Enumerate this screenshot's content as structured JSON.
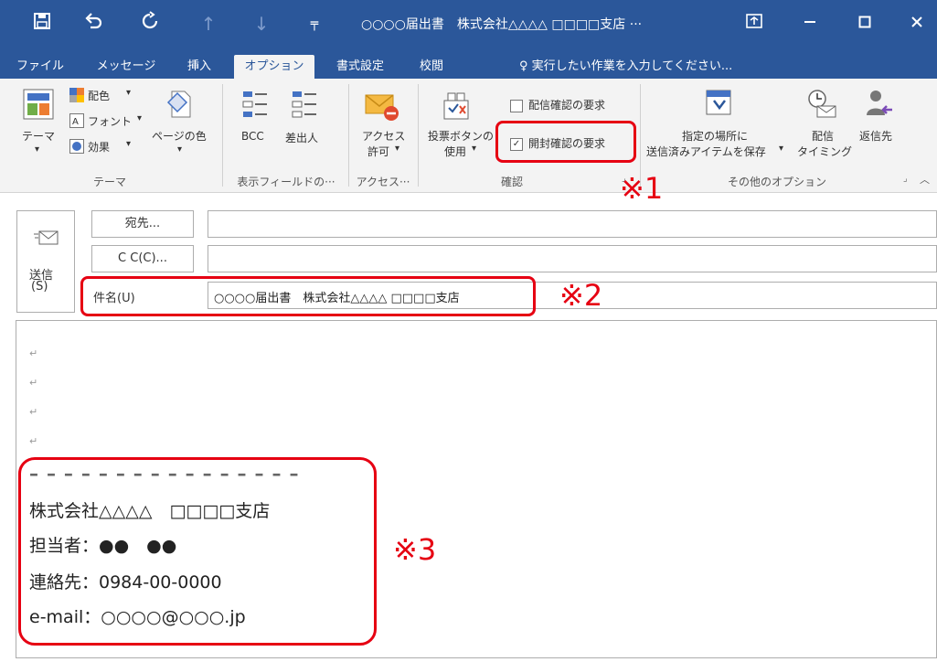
{
  "titlebar": {
    "title": "○○○○届出書　株式会社△△△△ □□□□支店 ···",
    "icons": [
      "save-icon",
      "undo-icon",
      "redo-icon",
      "up-arrow-icon",
      "down-arrow-icon",
      "customize-icon"
    ],
    "colors": {
      "bar": "#2b579a"
    }
  },
  "tabs": [
    {
      "label": "ファイル"
    },
    {
      "label": "メッセージ"
    },
    {
      "label": "挿入"
    },
    {
      "label": "オプション",
      "active": true
    },
    {
      "label": "書式設定"
    },
    {
      "label": "校閲"
    }
  ],
  "tellme": "♀ 実行したい作業を入力してください...",
  "ribbon": {
    "theme": {
      "theme_label": "テーマ",
      "color_label": "配色",
      "font_label": "フォント",
      "effect_label": "効果",
      "page_color_label": "ページの色",
      "group_label": "テーマ"
    },
    "fields": {
      "bcc_label": "BCC",
      "from_label": "差出人",
      "group_label": "表示フィールドの···"
    },
    "access": {
      "label_line1": "アクセス",
      "label_line2": "許可",
      "group_label": "アクセス···"
    },
    "tracking": {
      "vote_line1": "投票ボタンの",
      "vote_line2": "使用",
      "delivery_receipt": "配信確認の要求",
      "read_receipt": "開封確認の要求",
      "read_receipt_checked": true,
      "group_label": "確認"
    },
    "more": {
      "save_line1": "指定の場所に",
      "save_line2": "送信済みアイテムを保存",
      "delay_line1": "配信",
      "delay_line2": "タイミング",
      "reply_label": "返信先",
      "group_label": "その他のオプション"
    }
  },
  "header": {
    "send_label": "送信",
    "send_key": "(S)",
    "to_label": "宛先...",
    "cc_label": "C C(C)...",
    "subject_label": "件名(U)",
    "subject_value": "○○○○届出書　株式会社△△△△ □□□□支店"
  },
  "annotations": {
    "note1": "※1",
    "note2": "※2",
    "note3": "※3",
    "highlight_color": "#e60012"
  },
  "body": {
    "return_mark": "↵",
    "dash_line": "– – – – – – – – – – – – – – – –",
    "signature": {
      "company": "株式会社△△△△　□□□□支店",
      "person": "担当者：●●　●●",
      "phone": "連絡先：0984-00-0000",
      "email": "e-mail：○○○○@○○○.jp"
    }
  }
}
